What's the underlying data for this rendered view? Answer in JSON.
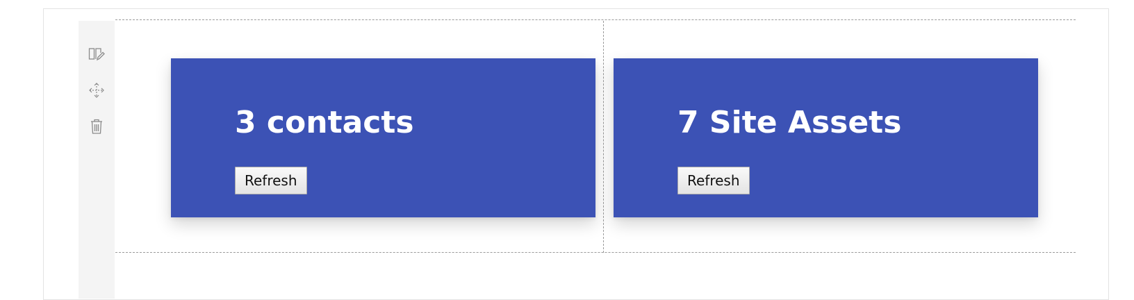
{
  "toolbar": {
    "icons": [
      "edit-webpart-icon",
      "move-icon",
      "delete-icon"
    ]
  },
  "cards": [
    {
      "title": "3 contacts",
      "button_label": "Refresh"
    },
    {
      "title": "7 Site Assets",
      "button_label": "Refresh"
    }
  ],
  "colors": {
    "card_background": "#3c52b5",
    "card_text": "#ffffff",
    "toolbar_background": "#f4f4f4",
    "icon_stroke": "#8a8a8a"
  }
}
